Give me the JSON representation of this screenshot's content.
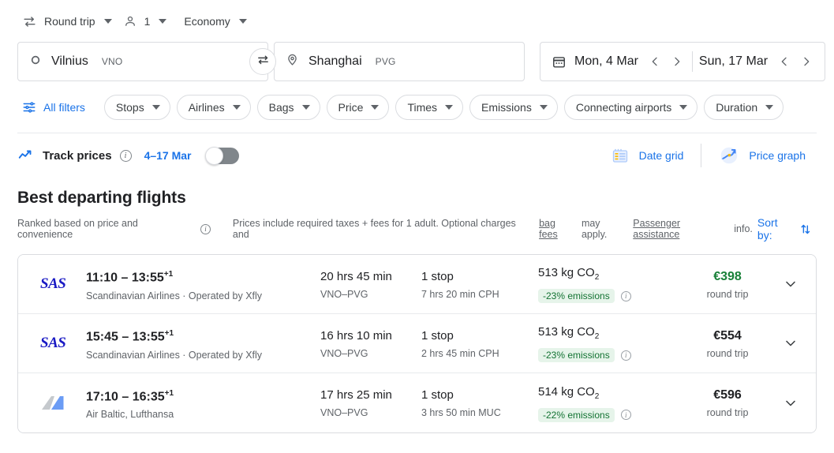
{
  "trip_options": [
    {
      "icon": "swap-horizontal-icon",
      "label": "Round trip"
    },
    {
      "icon": "person-icon",
      "label": "1"
    },
    {
      "icon": "",
      "label": "Economy"
    }
  ],
  "search": {
    "origin": {
      "city": "Vilnius",
      "code": "VNO",
      "icon": "circle-origin-icon"
    },
    "destination": {
      "city": "Shanghai",
      "code": "PVG",
      "icon": "map-pin-icon"
    },
    "swap_icon": "swap-arrows-icon",
    "calendar_icon": "calendar-icon",
    "depart_date": "Mon, 4 Mar",
    "return_date": "Sun, 17 Mar"
  },
  "filters": {
    "all_filters_label": "All filters",
    "all_filters_icon": "tune-filters-icon",
    "chips": [
      "Stops",
      "Airlines",
      "Bags",
      "Price",
      "Times",
      "Emissions",
      "Connecting airports",
      "Duration"
    ]
  },
  "track": {
    "icon": "trend-line-icon",
    "label": "Track prices",
    "info_icon": "info-icon",
    "range": "4–17 Mar",
    "toggle_on": false
  },
  "views": {
    "date_grid_label": "Date grid",
    "date_grid_icon": "calendar-grid-icon",
    "price_graph_label": "Price graph",
    "price_graph_icon": "price-graph-icon"
  },
  "section": {
    "title": "Best departing flights",
    "ranked_text": "Ranked based on price and convenience",
    "info_icon": "info-icon",
    "disclaimer_prefix": "Prices include required taxes + fees for 1 adult. Optional charges and",
    "bag_fees_link": "bag fees",
    "disclaimer_mid": "may apply.",
    "assistance_link": "Passenger assistance",
    "disclaimer_suffix": "info.",
    "sort_by_label": "Sort by:",
    "sort_icon": "sort-arrows-icon"
  },
  "flights": [
    {
      "logo_type": "sas",
      "logo_text": "SAS",
      "times": "11:10 – 13:55",
      "day_offset": "+1",
      "airline": "Scandinavian Airlines · Operated by Xfly",
      "duration": "20 hrs 45 min",
      "route": "VNO–PVG",
      "stops": "1 stop",
      "stop_detail": "7 hrs 20 min CPH",
      "co2_value": "513 kg CO",
      "co2_sub": "2",
      "emissions_badge": "-23% emissions",
      "emissions_info_icon": "info-icon",
      "price": "€398",
      "price_best": true,
      "price_sub": "round trip",
      "expand_icon": "chevron-down-icon"
    },
    {
      "logo_type": "sas",
      "logo_text": "SAS",
      "times": "15:45 – 13:55",
      "day_offset": "+1",
      "airline": "Scandinavian Airlines · Operated by Xfly",
      "duration": "16 hrs 10 min",
      "route": "VNO–PVG",
      "stops": "1 stop",
      "stop_detail": "2 hrs 45 min CPH",
      "co2_value": "513 kg CO",
      "co2_sub": "2",
      "emissions_badge": "-23% emissions",
      "emissions_info_icon": "info-icon",
      "price": "€554",
      "price_best": false,
      "price_sub": "round trip",
      "expand_icon": "chevron-down-icon"
    },
    {
      "logo_type": "multi",
      "logo_text": "",
      "times": "17:10 – 16:35",
      "day_offset": "+1",
      "airline": "Air Baltic, Lufthansa",
      "duration": "17 hrs 25 min",
      "route": "VNO–PVG",
      "stops": "1 stop",
      "stop_detail": "3 hrs 50 min MUC",
      "co2_value": "514 kg CO",
      "co2_sub": "2",
      "emissions_badge": "-22% emissions",
      "emissions_info_icon": "info-icon",
      "price": "€596",
      "price_best": false,
      "price_sub": "round trip",
      "expand_icon": "chevron-down-icon"
    }
  ],
  "colors": {
    "accent_blue": "#1a73e8",
    "price_green": "#188038",
    "emissions_bg": "#e6f4ea",
    "emissions_text": "#137333",
    "sas_blue": "#1b1bc4"
  }
}
